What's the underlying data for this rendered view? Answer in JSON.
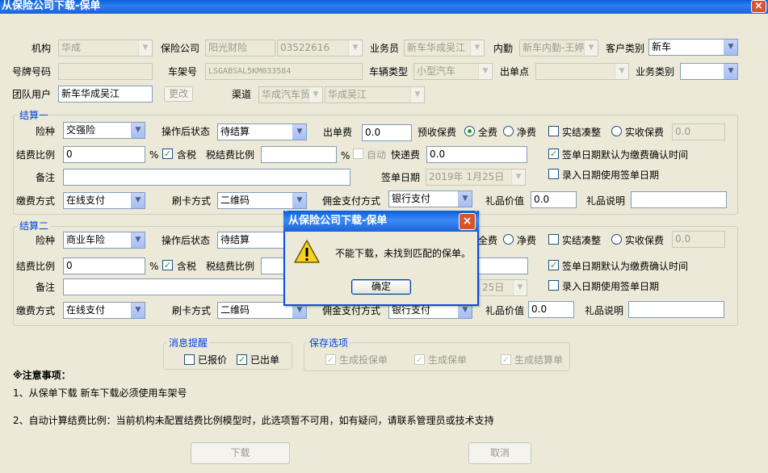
{
  "window": {
    "title": "从保险公司下载-保单",
    "close": "×"
  },
  "top": {
    "org_label": "机构",
    "org_value": "华成",
    "insurer_label": "保险公司",
    "insurer_value": "阳光财险",
    "insurer_code": "03522616",
    "salesman_label": "业务员",
    "salesman_value": "新车华成吴江",
    "internal_label": "内勤",
    "internal_value": "新车内勤-王婷",
    "custtype_label": "客户类别",
    "custtype_value": "新车",
    "plate_label": "号牌号码",
    "plate_value": "",
    "vin_label": "车架号",
    "vin_value": "LSGABSAL5KM033584",
    "vehtype_label": "车辆类型",
    "vehtype_value": "小型汽车",
    "issuepoint_label": "出单点",
    "issuepoint_value": "",
    "biztype_label": "业务类别",
    "biztype_value": "",
    "team_label": "团队用户",
    "team_value": "新车华成吴江",
    "change_btn": "更改",
    "channel_label": "渠道",
    "channel_value1": "华成汽车贸",
    "channel_value2": "华成吴江"
  },
  "s1": {
    "title": "结算一",
    "kind_label": "险种",
    "kind_value": "交强险",
    "status_label": "操作后状态",
    "status_value": "待结算",
    "fee_label": "出单费",
    "fee_value": "0.0",
    "prepay_label": "预收保费",
    "full_label": "全费",
    "net_label": "净费",
    "round_label": "实结凑整",
    "actual_label": "实收保费",
    "actual_value": "0.0",
    "ratio_label": "结费比例",
    "ratio_value": "0",
    "pct": "%",
    "tax_label": "含税",
    "taxratio_label": "税结费比例",
    "taxratio_value": "",
    "pct2": "%",
    "auto_label": "自动",
    "express_label": "快递费",
    "express_value": "0.0",
    "signdef_label": "签单日期默认为缴费确认时间",
    "note_label": "备注",
    "note_value": "",
    "signdate_label": "签单日期",
    "signdate_value": "2019年 1月25日",
    "entrydate_label": "录入日期使用签单日期",
    "pay_label": "缴费方式",
    "pay_value": "在线支付",
    "card_label": "刷卡方式",
    "card_value": "二维码",
    "comm_label": "佣金支付方式",
    "comm_value": "银行支付",
    "gift_label": "礼品价值",
    "gift_value": "0.0",
    "giftdesc_label": "礼品说明",
    "giftdesc_value": ""
  },
  "s2": {
    "title": "结算二",
    "kind_label": "险种",
    "kind_value": "商业车险",
    "status_label": "操作后状态",
    "status_value": "待结算",
    "full_label": "全费",
    "net_label": "净费",
    "round_label": "实结凑整",
    "actual_label": "实收保费",
    "actual_value": "0.0",
    "ratio_label": "结费比例",
    "ratio_value": "0",
    "pct": "%",
    "tax_label": "含税",
    "taxratio_label": "税结费比例",
    "signdef_label": "签单日期默认为缴费确认时间",
    "note_label": "备注",
    "signdate_partial": "25日",
    "entrydate_label": "录入日期使用签单日期",
    "pay_label": "缴费方式",
    "pay_value": "在线支付",
    "card_label": "刷卡方式",
    "card_value": "二维码",
    "comm_label": "佣金支付方式",
    "comm_value": "银行支付",
    "gift_label": "礼品价值",
    "gift_value": "0.0",
    "giftdesc_label": "礼品说明"
  },
  "msg": {
    "title": "消息提醒",
    "quoted": "已报价",
    "issued": "已出单"
  },
  "save": {
    "title": "保存选项",
    "opt1": "生成投保单",
    "opt2": "生成保单",
    "opt3": "生成结算单"
  },
  "notes": {
    "title": "※注意事项：",
    "line1": "1、从保单下载 新车下载必须使用车架号",
    "line2": "2、自动计算结费比例：当前机构未配置结费比例模型时，此选项暂不可用，如有疑问，请联系管理员或技术支持"
  },
  "footer": {
    "download": "下载",
    "cancel": "取消"
  },
  "dialog": {
    "title": "从保险公司下载-保单",
    "message": "不能下载，未找到匹配的保单。",
    "ok": "确定",
    "close": "×"
  }
}
